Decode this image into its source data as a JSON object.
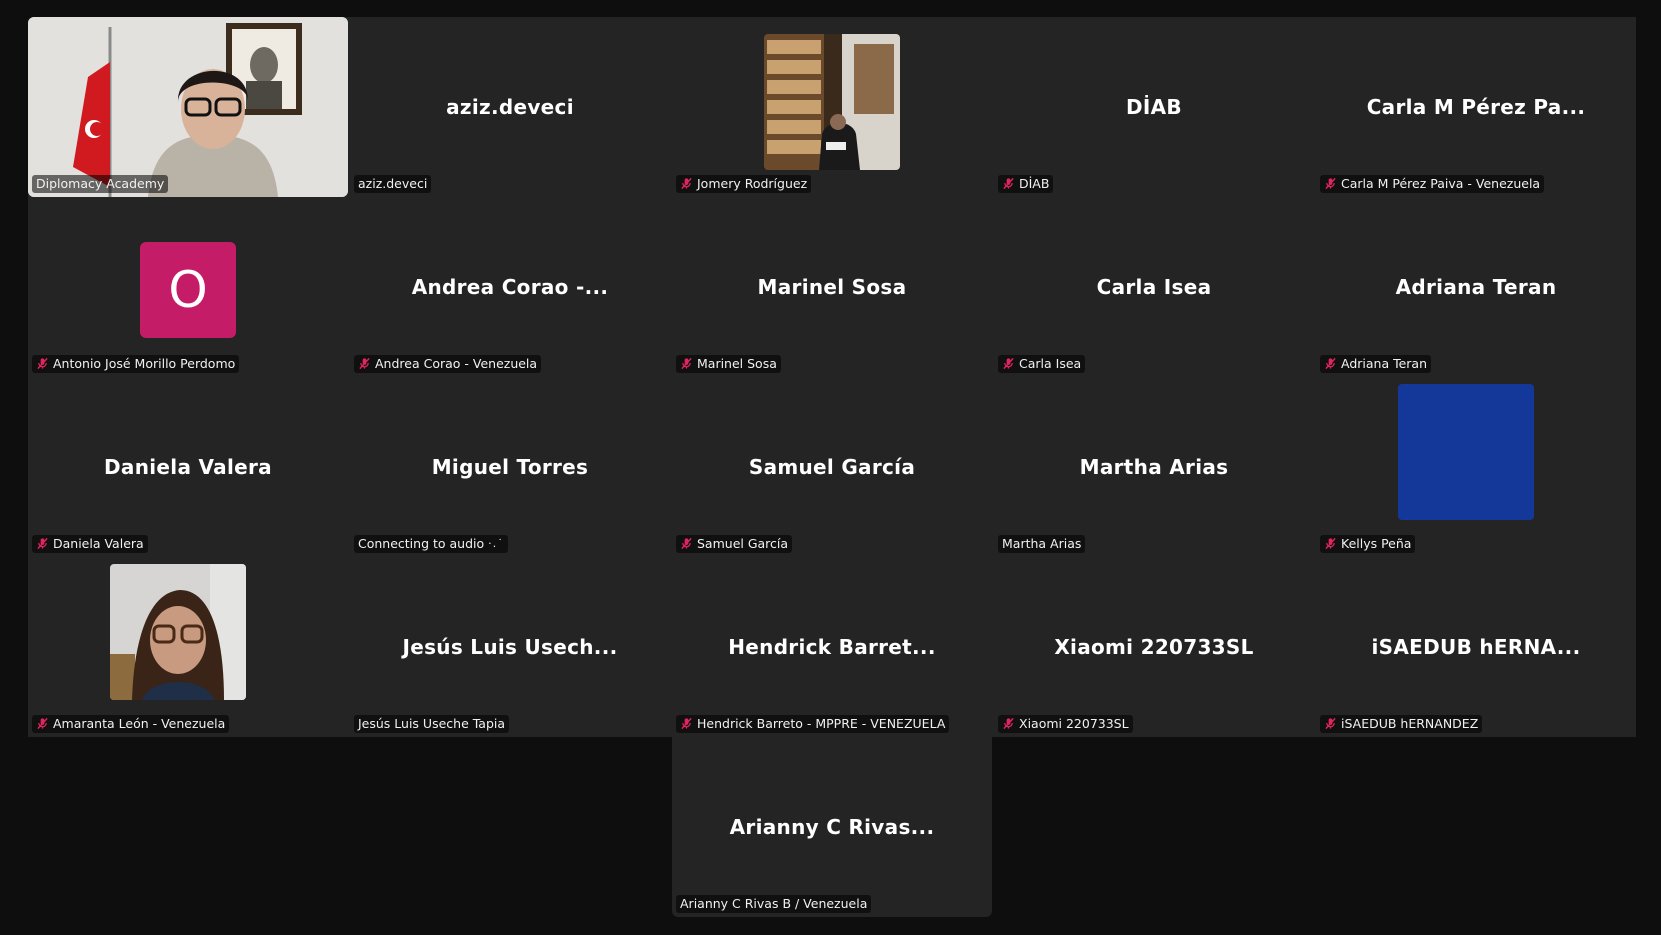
{
  "colors": {
    "background": "#0e0e0e",
    "tile": "#242424",
    "active_speaker": "#3ad17a",
    "mute": "#e0245e",
    "avatar_magenta": "#c41c66",
    "avatar_blue": "#14379a"
  },
  "participants": [
    {
      "tile_label": "",
      "tag": "Diplomacy Academy",
      "muted": false,
      "kind": "video-office",
      "active": true
    },
    {
      "tile_label": "aziz.deveci",
      "tag": "aziz.deveci",
      "muted": false,
      "kind": "name"
    },
    {
      "tile_label": "",
      "tag": "Jomery Rodríguez",
      "muted": true,
      "kind": "video-library"
    },
    {
      "tile_label": "DİAB",
      "tag": "DİAB",
      "muted": true,
      "kind": "name"
    },
    {
      "tile_label": "Carla M Pérez Pa...",
      "tag": "Carla M Pérez Paiva - Venezuela",
      "muted": true,
      "kind": "name"
    },
    {
      "tile_label": "",
      "tag": "Antonio José Morillo Perdomo",
      "muted": true,
      "kind": "initial",
      "initial": "O"
    },
    {
      "tile_label": "Andrea Corao -...",
      "tag": "Andrea Corao - Venezuela",
      "muted": true,
      "kind": "name"
    },
    {
      "tile_label": "Marinel Sosa",
      "tag": "Marinel Sosa",
      "muted": true,
      "kind": "name"
    },
    {
      "tile_label": "Carla Isea",
      "tag": "Carla Isea",
      "muted": true,
      "kind": "name"
    },
    {
      "tile_label": "Adriana Teran",
      "tag": "Adriana Teran",
      "muted": true,
      "kind": "name"
    },
    {
      "tile_label": "Daniela Valera",
      "tag": "Daniela Valera",
      "muted": true,
      "kind": "name"
    },
    {
      "tile_label": "Miguel Torres",
      "tag": "Connecting to audio",
      "muted": false,
      "kind": "name",
      "connecting": true
    },
    {
      "tile_label": "Samuel García",
      "tag": "Samuel García",
      "muted": true,
      "kind": "name"
    },
    {
      "tile_label": "Martha Arias",
      "tag": "Martha Arias",
      "muted": false,
      "kind": "name"
    },
    {
      "tile_label": "",
      "tag": "Kellys Peña",
      "muted": true,
      "kind": "blue-square"
    },
    {
      "tile_label": "",
      "tag": "Amaranta León - Venezuela",
      "muted": true,
      "kind": "video-portrait"
    },
    {
      "tile_label": "Jesús Luis Usech...",
      "tag": "Jesús Luis Useche Tapia",
      "muted": false,
      "kind": "name"
    },
    {
      "tile_label": "Hendrick Barret...",
      "tag": "Hendrick Barreto - MPPRE - VENEZUELA",
      "muted": true,
      "kind": "name"
    },
    {
      "tile_label": "Xiaomi 220733SL",
      "tag": "Xiaomi 220733SL",
      "muted": true,
      "kind": "name"
    },
    {
      "tile_label": "iSAEDUB  hERNA...",
      "tag": "iSAEDUB hERNANDEZ",
      "muted": true,
      "kind": "name"
    },
    {
      "tile_label": "Arianny C Rivas...",
      "tag": "Arianny C Rivas B / Venezuela",
      "muted": false,
      "kind": "name"
    }
  ]
}
